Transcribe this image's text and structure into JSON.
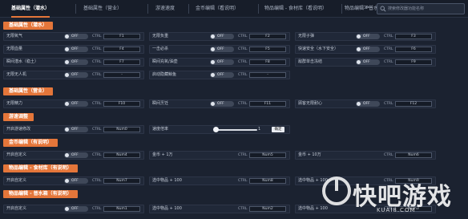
{
  "tabs": [
    {
      "label": "基础属性（潜水）",
      "active": true
    },
    {
      "label": "基础属性（营业）"
    },
    {
      "label": "游速速度"
    },
    {
      "label": "金币编辑（看说明）"
    },
    {
      "label": "物品编辑 - 食材库（看说明）"
    },
    {
      "label": "物品编辑 - 普水箱"
    }
  ],
  "tab_more": "≫",
  "search": {
    "placeholder": "搜索修改器功能名称"
  },
  "toggle_off": "OFF",
  "ctrl_label": "CTRL",
  "sections": [
    "基础属性（潜水）",
    "基础属性（营业）",
    "游速调整",
    "金币编辑（有说明）",
    "物品编辑 - 食材库（有说明）",
    "物品编辑 - 普水箱（有说明）"
  ],
  "rows": {
    "dive_a": [
      {
        "label": "无限氧气",
        "key": "F1"
      },
      {
        "label": "无限血量",
        "key": "F4"
      },
      {
        "label": "瞬间潜水（稳土）",
        "key": "F7"
      },
      {
        "label": "无限无人机",
        "key": "-"
      }
    ],
    "dive_b": [
      {
        "label": "无限负重",
        "key": "F2"
      },
      {
        "label": "一击必杀",
        "key": "F5"
      },
      {
        "label": "瞬间充氧/油壶",
        "key": "F8"
      },
      {
        "label": "启动隐藏鲸鱼",
        "key": "-"
      }
    ],
    "dive_c": [
      {
        "label": "无限子弹",
        "key": "F3"
      },
      {
        "label": "快速安全（水下安全）",
        "key": "F6"
      },
      {
        "label": "敌群单击冻结",
        "key": "F9"
      }
    ],
    "biz": [
      {
        "label": "无限精力",
        "key": "F10"
      },
      {
        "label": "瞬间烹饪",
        "key": "F11"
      },
      {
        "label": "顾客无限耐心",
        "key": "F12"
      }
    ],
    "speed": {
      "label": "开启游速修改",
      "key": "Num0",
      "speed_label": "速度倍率",
      "value": "1",
      "confirm": "确定"
    },
    "gold": [
      {
        "label": "开启自定义",
        "key": "Num4"
      },
      {
        "label": "金币 + 1万",
        "key": "Num5"
      },
      {
        "label": "金币 + 10万",
        "key": "Num6"
      }
    ],
    "ingredients": [
      {
        "label": "开启自定义",
        "key": "Num7"
      },
      {
        "label": "选中物品 + 100",
        "key": "Num8"
      },
      {
        "label": "选中物品 + 100",
        "key": "Num9"
      }
    ],
    "tank": [
      {
        "label": "开启自定义",
        "key": "Num1"
      },
      {
        "label": "选中物品 + 100",
        "key": "Num2"
      },
      {
        "label": "选中物品 + 100",
        "key": "Num3"
      }
    ]
  },
  "watermark": {
    "name": "快吧游戏",
    "url": "KUAI8.COM"
  },
  "colors": {
    "accent": "#e4763a",
    "background": "#1b2230",
    "row": "#202838"
  }
}
